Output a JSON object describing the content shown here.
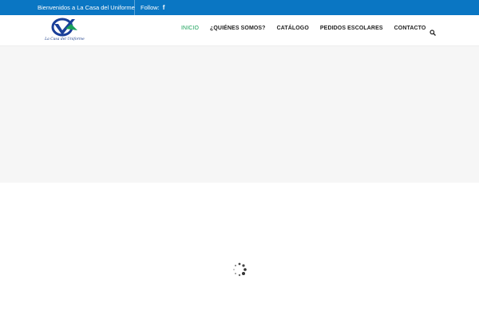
{
  "topbar": {
    "welcome": "Bienvenidos a La Casa del Uniforme",
    "follow_label": "Follow:",
    "social_icon": "facebook-icon"
  },
  "logo": {
    "text": "La Casa del Uniforme"
  },
  "nav": {
    "items": [
      {
        "label": "INICIO"
      },
      {
        "label": "¿QUIÉNES SOMOS?"
      },
      {
        "label": "CATÁLOGO"
      },
      {
        "label": "PEDIDOS ESCOLARES"
      },
      {
        "label": "CONTACTO"
      }
    ],
    "active_index": 0,
    "search_icon": "search-icon"
  },
  "loader": {
    "icon": "spinner-icon"
  },
  "colors": {
    "topbar": "#0a76c3",
    "accent_active": "#1aa15a",
    "hero_bg": "#f6f6f6",
    "nav_text": "#222222"
  }
}
